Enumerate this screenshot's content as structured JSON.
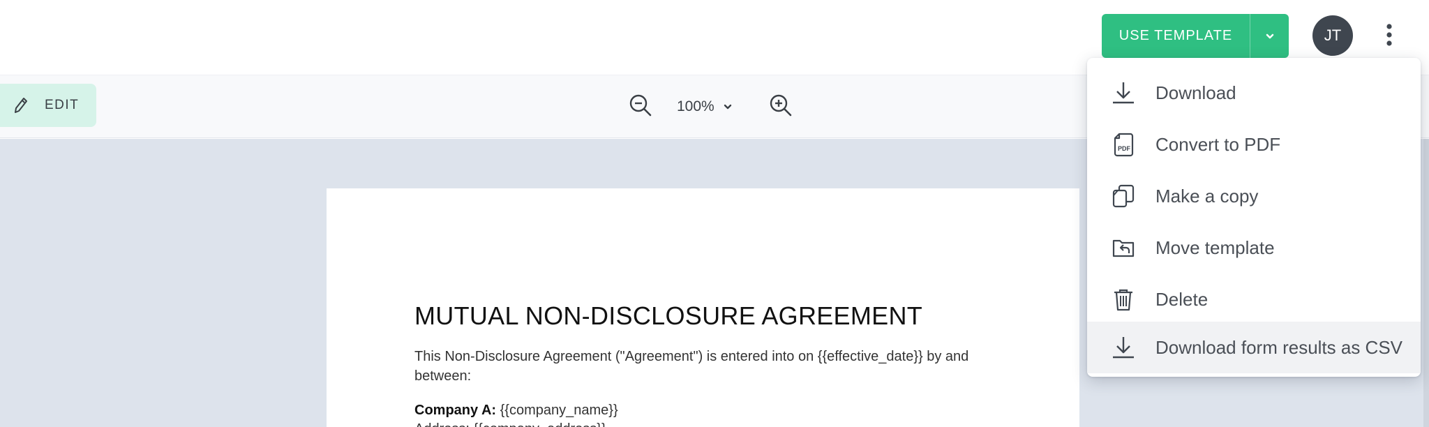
{
  "header": {
    "use_template_label": "USE TEMPLATE",
    "avatar_initials": "JT",
    "accent_color": "#2fbf82"
  },
  "toolbar": {
    "edit_label": "EDIT",
    "zoom_level": "100%"
  },
  "document": {
    "title": "MUTUAL NON-DISCLOSURE AGREEMENT",
    "intro": "This Non-Disclosure Agreement (\"Agreement\") is entered into on {{effective_date}} by and between:",
    "company_a_label": "Company A:",
    "company_a_value": "{{company_name}}",
    "address_partial": "Address: {{company_address}}"
  },
  "menu": {
    "items": [
      {
        "label": "Download",
        "icon": "download-icon"
      },
      {
        "label": "Convert to PDF",
        "icon": "pdf-file-icon"
      },
      {
        "label": "Make a copy",
        "icon": "copy-icon"
      },
      {
        "label": "Move template",
        "icon": "move-folder-icon"
      },
      {
        "label": "Delete",
        "icon": "trash-icon"
      },
      {
        "label": "Download form results as CSV",
        "icon": "download-icon"
      }
    ]
  }
}
